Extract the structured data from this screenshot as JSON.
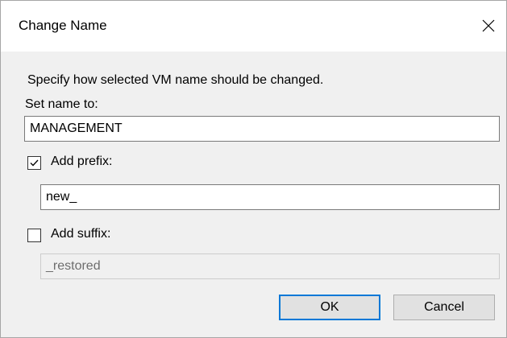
{
  "dialog": {
    "title": "Change Name",
    "description": "Specify how selected VM name should be changed.",
    "name": {
      "label": "Set name to:",
      "value": "MANAGEMENT"
    },
    "prefix": {
      "label": "Add prefix:",
      "checked": true,
      "value": "new_"
    },
    "suffix": {
      "label": "Add suffix:",
      "checked": false,
      "value": "_restored"
    },
    "buttons": {
      "ok": "OK",
      "cancel": "Cancel"
    }
  }
}
